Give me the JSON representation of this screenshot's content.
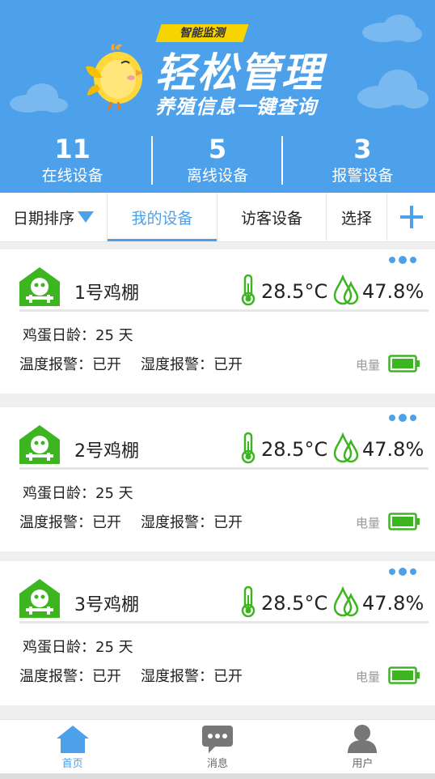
{
  "header": {
    "tag": "智能监测",
    "title": "轻松管理",
    "subtitle": "养殖信息一键查询"
  },
  "stats": [
    {
      "num": "11",
      "label": "在线设备"
    },
    {
      "num": "5",
      "label": "离线设备"
    },
    {
      "num": "3",
      "label": "报警设备"
    }
  ],
  "tabs": {
    "sort": "日期排序",
    "mine": "我的设备",
    "visitor": "访客设备",
    "select": "选择",
    "add_icon": "plus-icon"
  },
  "cards": [
    {
      "name": "1号鸡棚",
      "temp": "28.5°C",
      "hum": "47.8%",
      "age": "鸡蛋日龄：25 天",
      "temp_alarm": "温度报警：已开",
      "hum_alarm": "湿度报警：已开",
      "power": "电量"
    },
    {
      "name": "2号鸡棚",
      "temp": "28.5°C",
      "hum": "47.8%",
      "age": "鸡蛋日龄：25 天",
      "temp_alarm": "温度报警：已开",
      "hum_alarm": "湿度报警：已开",
      "power": "电量"
    },
    {
      "name": "3号鸡棚",
      "temp": "28.5°C",
      "hum": "47.8%",
      "age": "鸡蛋日龄：25 天",
      "temp_alarm": "温度报警：已开",
      "hum_alarm": "湿度报警：已开",
      "power": "电量"
    }
  ],
  "nav": [
    {
      "label": "首页",
      "icon": "home-icon"
    },
    {
      "label": "消息",
      "icon": "message-icon"
    },
    {
      "label": "用户",
      "icon": "user-icon"
    }
  ],
  "colors": {
    "primary": "#4da1ea",
    "green": "#3cb521",
    "yellow": "#f7d300"
  }
}
